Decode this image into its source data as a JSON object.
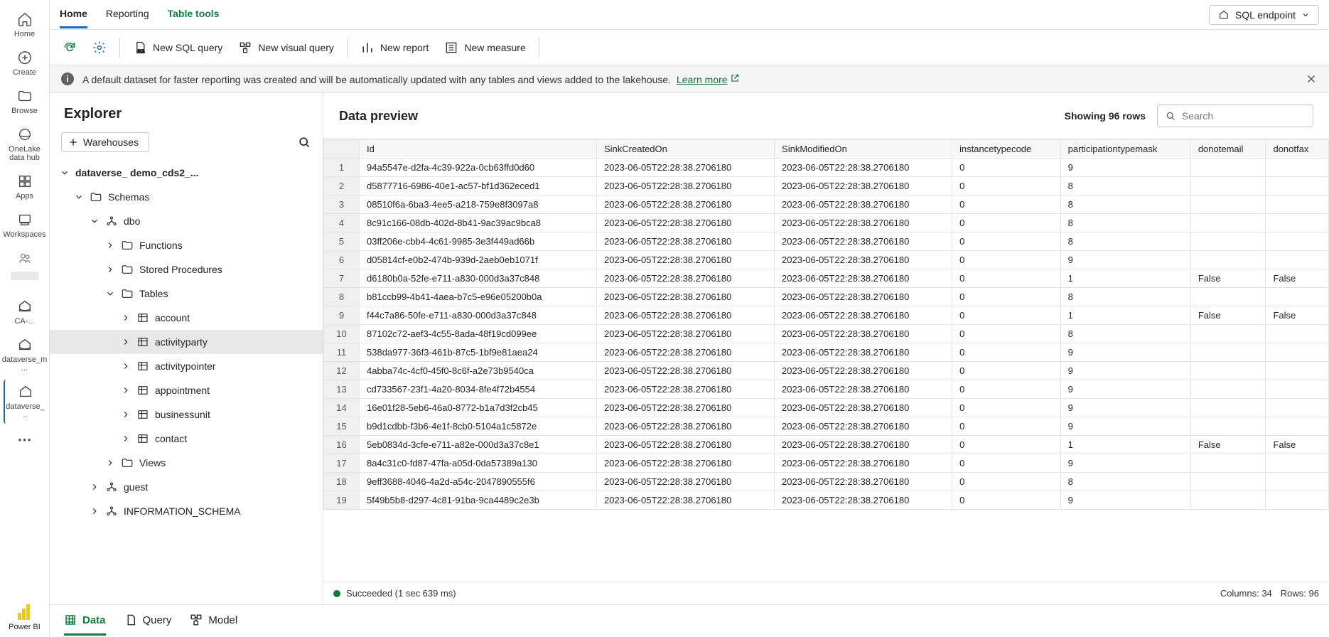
{
  "leftnav": {
    "home": "Home",
    "create": "Create",
    "browse": "Browse",
    "onelake": "OneLake\ndata hub",
    "apps": "Apps",
    "workspaces": "Workspaces",
    "ca": "CA-...",
    "dm": "dataverse_m\n...",
    "dv": "dataverse_\n..",
    "powerbi": "Power BI"
  },
  "tabs": {
    "home": "Home",
    "reporting": "Reporting",
    "tabletools": "Table tools",
    "sqlendpoint": "SQL endpoint"
  },
  "toolbar": {
    "newsql": "New SQL query",
    "newvisual": "New visual query",
    "newreport": "New report",
    "newmeasure": "New measure"
  },
  "banner": {
    "text": "A default dataset for faster reporting was created and will be automatically updated with any tables and views added to the lakehouse.",
    "link": "Learn more"
  },
  "explorer": {
    "title": "Explorer",
    "warehouses": "Warehouses",
    "dbname": "dataverse_          demo_cds2_...",
    "schemas": "Schemas",
    "dbo": "dbo",
    "functions": "Functions",
    "sprocs": "Stored Procedures",
    "tables": "Tables",
    "t_account": "account",
    "t_activityparty": "activityparty",
    "t_activitypointer": "activitypointer",
    "t_appointment": "appointment",
    "t_businessunit": "businessunit",
    "t_contact": "contact",
    "views": "Views",
    "guest": "guest",
    "infoschema": "INFORMATION_SCHEMA"
  },
  "preview": {
    "title": "Data preview",
    "showing": "Showing 96 rows",
    "search_placeholder": "Search",
    "columns": [
      "",
      "Id",
      "SinkCreatedOn",
      "SinkModifiedOn",
      "instancetypecode",
      "participationtypemask",
      "donotemail",
      "donotfax"
    ],
    "rows": [
      [
        "1",
        "94a5547e-d2fa-4c39-922a-0cb63ffd0d60",
        "2023-06-05T22:28:38.2706180",
        "2023-06-05T22:28:38.2706180",
        "0",
        "9",
        "",
        ""
      ],
      [
        "2",
        "d5877716-6986-40e1-ac57-bf1d362eced1",
        "2023-06-05T22:28:38.2706180",
        "2023-06-05T22:28:38.2706180",
        "0",
        "8",
        "",
        ""
      ],
      [
        "3",
        "08510f6a-6ba3-4ee5-a218-759e8f3097a8",
        "2023-06-05T22:28:38.2706180",
        "2023-06-05T22:28:38.2706180",
        "0",
        "8",
        "",
        ""
      ],
      [
        "4",
        "8c91c166-08db-402d-8b41-9ac39ac9bca8",
        "2023-06-05T22:28:38.2706180",
        "2023-06-05T22:28:38.2706180",
        "0",
        "8",
        "",
        ""
      ],
      [
        "5",
        "03ff206e-cbb4-4c61-9985-3e3f449ad66b",
        "2023-06-05T22:28:38.2706180",
        "2023-06-05T22:28:38.2706180",
        "0",
        "8",
        "",
        ""
      ],
      [
        "6",
        "d05814cf-e0b2-474b-939d-2aeb0eb1071f",
        "2023-06-05T22:28:38.2706180",
        "2023-06-05T22:28:38.2706180",
        "0",
        "9",
        "",
        ""
      ],
      [
        "7",
        "d6180b0a-52fe-e711-a830-000d3a37c848",
        "2023-06-05T22:28:38.2706180",
        "2023-06-05T22:28:38.2706180",
        "0",
        "1",
        "False",
        "False"
      ],
      [
        "8",
        "b81ccb99-4b41-4aea-b7c5-e96e05200b0a",
        "2023-06-05T22:28:38.2706180",
        "2023-06-05T22:28:38.2706180",
        "0",
        "8",
        "",
        ""
      ],
      [
        "9",
        "f44c7a86-50fe-e711-a830-000d3a37c848",
        "2023-06-05T22:28:38.2706180",
        "2023-06-05T22:28:38.2706180",
        "0",
        "1",
        "False",
        "False"
      ],
      [
        "10",
        "87102c72-aef3-4c55-8ada-48f19cd099ee",
        "2023-06-05T22:28:38.2706180",
        "2023-06-05T22:28:38.2706180",
        "0",
        "8",
        "",
        ""
      ],
      [
        "11",
        "538da977-36f3-461b-87c5-1bf9e81aea24",
        "2023-06-05T22:28:38.2706180",
        "2023-06-05T22:28:38.2706180",
        "0",
        "9",
        "",
        ""
      ],
      [
        "12",
        "4abba74c-4cf0-45f0-8c6f-a2e73b9540ca",
        "2023-06-05T22:28:38.2706180",
        "2023-06-05T22:28:38.2706180",
        "0",
        "9",
        "",
        ""
      ],
      [
        "13",
        "cd733567-23f1-4a20-8034-8fe4f72b4554",
        "2023-06-05T22:28:38.2706180",
        "2023-06-05T22:28:38.2706180",
        "0",
        "9",
        "",
        ""
      ],
      [
        "14",
        "16e01f28-5eb6-46a0-8772-b1a7d3f2cb45",
        "2023-06-05T22:28:38.2706180",
        "2023-06-05T22:28:38.2706180",
        "0",
        "9",
        "",
        ""
      ],
      [
        "15",
        "b9d1cdbb-f3b6-4e1f-8cb0-5104a1c5872e",
        "2023-06-05T22:28:38.2706180",
        "2023-06-05T22:28:38.2706180",
        "0",
        "9",
        "",
        ""
      ],
      [
        "16",
        "5eb0834d-3cfe-e711-a82e-000d3a37c8e1",
        "2023-06-05T22:28:38.2706180",
        "2023-06-05T22:28:38.2706180",
        "0",
        "1",
        "False",
        "False"
      ],
      [
        "17",
        "8a4c31c0-fd87-47fa-a05d-0da57389a130",
        "2023-06-05T22:28:38.2706180",
        "2023-06-05T22:28:38.2706180",
        "0",
        "9",
        "",
        ""
      ],
      [
        "18",
        "9eff3688-4046-4a2d-a54c-2047890555f6",
        "2023-06-05T22:28:38.2706180",
        "2023-06-05T22:28:38.2706180",
        "0",
        "8",
        "",
        ""
      ],
      [
        "19",
        "5f49b5b8-d297-4c81-91ba-9ca4489c2e3b",
        "2023-06-05T22:28:38.2706180",
        "2023-06-05T22:28:38.2706180",
        "0",
        "9",
        "",
        ""
      ]
    ]
  },
  "status": {
    "succeeded": "Succeeded (1 sec 639 ms)",
    "cols": "Columns:  34",
    "rows": "Rows:  96"
  },
  "bottomtabs": {
    "data": "Data",
    "query": "Query",
    "model": "Model"
  }
}
